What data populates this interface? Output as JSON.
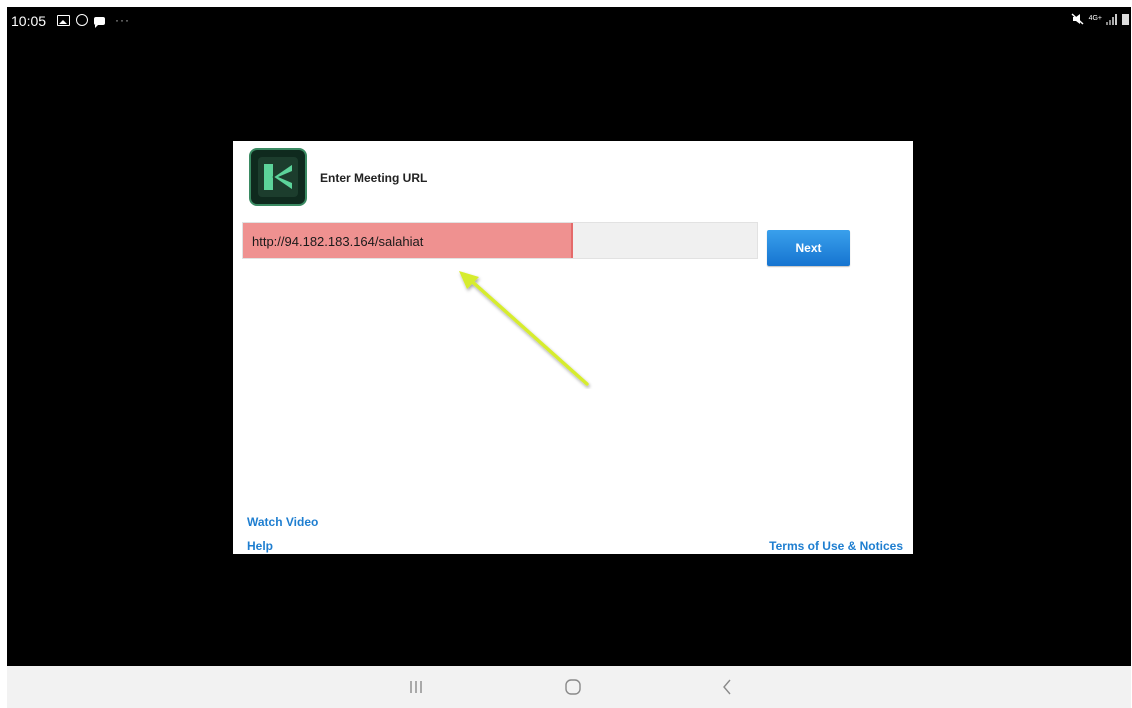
{
  "status_bar": {
    "time": "10:05",
    "more": "···",
    "network_label": "4G+"
  },
  "dialog": {
    "title": "Enter Meeting URL",
    "url_value": "http://94.182.183.164/salahiat",
    "next_label": "Next",
    "watch_video_label": "Watch Video",
    "help_label": "Help",
    "terms_label": "Terms of Use & Notices"
  },
  "colors": {
    "highlight": "#ef9190",
    "next_button": "#1e86de",
    "link": "#1e7ed0",
    "annotation_arrow": "#d6ec2e",
    "logo_bg": "#0f2a1e"
  },
  "icons": [
    "gallery-icon",
    "whatsapp-icon",
    "chat-icon",
    "mute-icon",
    "signal-icon",
    "battery-icon",
    "app-logo-icon",
    "recents-icon",
    "home-icon",
    "back-icon"
  ]
}
